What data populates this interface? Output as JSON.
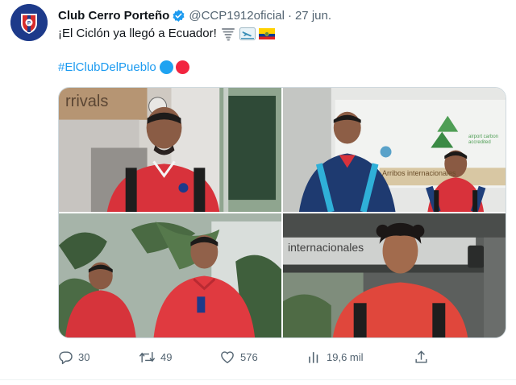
{
  "tweet": {
    "author_name": "Club Cerro Porteño",
    "handle": "@CCP1912oficial",
    "separator": "·",
    "date": "27 jun.",
    "text": "¡El Ciclón ya llegó a Ecuador!",
    "hashtag": "#ElClubDelPueblo",
    "emojis": [
      "tornado-icon",
      "airplane-arrival-icon",
      "ecuador-flag-icon",
      "blue-circle-icon",
      "red-circle-icon"
    ]
  },
  "photos": {
    "photo1_sign": "rrivals",
    "photo2_sign": "Arribos internacionales",
    "photo2_logo": "airport carbon accredited",
    "photo4_sign": "internacionales"
  },
  "actions": {
    "replies": "30",
    "retweets": "49",
    "likes": "576",
    "views": "19,6 mil"
  },
  "colors": {
    "accent": "#1d9bf0",
    "muted": "#536471",
    "club_red": "#d62b2b",
    "club_blue": "#1d3a8a"
  }
}
